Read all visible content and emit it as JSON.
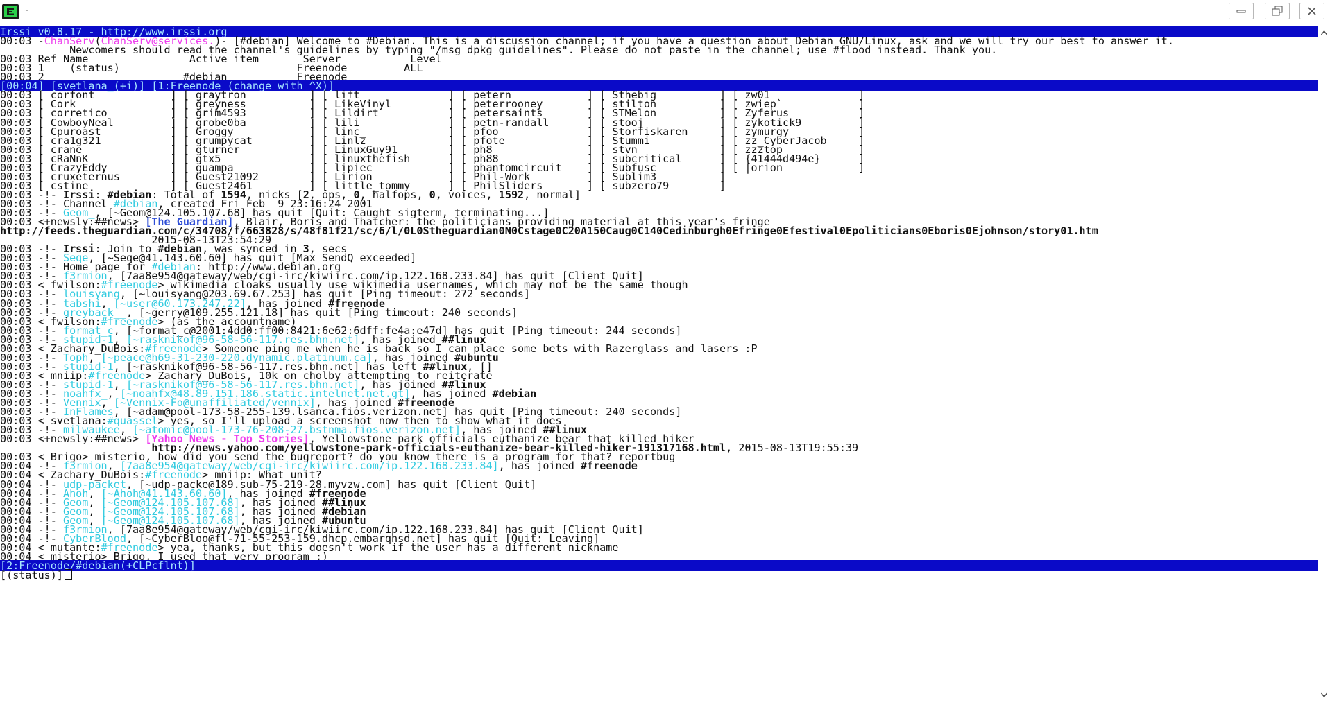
{
  "window": {
    "title": "~"
  },
  "icons": {
    "app": "terminal-app-icon",
    "minimize": "minimize-icon",
    "maximize": "restore-icon",
    "close": "close-icon",
    "scroll_up": "arrow-up-icon",
    "scroll_down": "arrow-down-icon"
  },
  "colors": {
    "status_bar_bg": "#0a0ac8",
    "status_bar_fg": "#a6e4ff",
    "nick_cyan": "#31cbe0",
    "nick_magenta": "#ee3dee",
    "link_blue": "#2d4dd6",
    "text": "#111111",
    "background": "#ffffff"
  },
  "prompt": {
    "window_label": "[(status)]"
  },
  "lines": [
    [
      [
        "",
        "Irssi v0.8.17 - http://www.irssi.org"
      ]
    ],
    [
      [
        "",
        "00:03 -"
      ],
      [
        "m",
        "ChanServ"
      ],
      [
        "",
        "("
      ],
      [
        "m",
        "ChanServ@services."
      ],
      [
        "",
        ")- [#debian] Welcome to #Debian. This is a discussion channel; if you have a question about Debian GNU/Linux, ask and we will try our best to answer it."
      ]
    ],
    [
      [
        "",
        "           Newcomers should read the channel's guidelines by typing \"/msg dpkg guidelines\". Please do not paste in the channel; use #flood instead. Thank you."
      ]
    ],
    [
      [
        "",
        "00:03 Ref Name                Active item       Server           Level"
      ]
    ],
    [
      [
        "",
        "00:03 1    (status)                            Freenode         ALL"
      ]
    ],
    [
      [
        "",
        "00:03 2                      #debian           Freenode"
      ]
    ],
    [
      [
        "",
        "[00:04] [svetlana_(+i)] [1:Freenode (change with ^X)]"
      ]
    ],
    [
      [
        "",
        "00:03 [ corfont            ] [ graytron          ] [ lift              ] [ petern_           ] [ Sthebig          ] [ zw01              ]"
      ]
    ],
    [
      [
        "",
        "00:03 [ Cork               ] [ greyness          ] [ LikeVinyl         ] [ peterrooney       ] [ stilton          ] [ zwiep`            ]"
      ]
    ],
    [
      [
        "",
        "00:03 [ corretico          ] [ grim4593          ] [ Lildirt           ] [ petersaints       ] [ STMelon          ] [ Zyferus           ]"
      ]
    ],
    [
      [
        "",
        "00:03 [ CowboyNeal         ] [ grobe0ba          ] [ lili              ] [ petn-randall      ] [ stooj            ] [ zykotick9         ]"
      ]
    ],
    [
      [
        "",
        "00:03 [ Cpuroast           ] [ Groggy            ] [ linc_             ] [ pfoo              ] [ Storfiskaren     ] [ zymurgy           ]"
      ]
    ],
    [
      [
        "",
        "00:03 [ cra1g321           ] [ grumpycat         ] [ Linlz             ] [ pfote             ] [ Stummi           ] [ zz_CyberJacob     ]"
      ]
    ],
    [
      [
        "",
        "00:03 [ crane              ] [ gturner           ] [ LinuxGuy91        ] [ ph8               ] [ stvn             ] [ zzztop            ]"
      ]
    ],
    [
      [
        "",
        "00:03 [ cRaNnK             ] [ gtx5              ] [ linuxthefish      ] [ ph88              ] [ subcritical      ] [ {41444d494e}      ]"
      ]
    ],
    [
      [
        "",
        "00:03 [ CrazyEddy          ] [ guampa            ] [ lipiec            ] [ phantomcircuit    ] [ Subfusc          ] [ |orion            ]"
      ]
    ],
    [
      [
        "",
        "00:03 [ cruxeternus        ] [ Guest21092        ] [ Lirion            ] [ Phil-Work         ] [ Sublim3          ]"
      ]
    ],
    [
      [
        "",
        "00:03 [ cstine             ] [ Guest2461         ] [ little_tommy      ] [ PhilSliders       ] [ subzero79        ]"
      ]
    ],
    [
      [
        "",
        "00:03 -!- "
      ],
      [
        "b",
        "Irssi"
      ],
      [
        "",
        ": "
      ],
      [
        "b",
        "#debian"
      ],
      [
        "",
        ": Total of "
      ],
      [
        "b",
        "1594"
      ],
      [
        "",
        ", nicks ["
      ],
      [
        "b",
        "2"
      ],
      [
        "",
        ", ops, "
      ],
      [
        "b",
        "0"
      ],
      [
        "",
        ", halfops, "
      ],
      [
        "b",
        "0"
      ],
      [
        "",
        ", voices, "
      ],
      [
        "b",
        "1592"
      ],
      [
        "",
        ", normal]"
      ]
    ],
    [
      [
        "",
        "00:03 -!- Channel "
      ],
      [
        "c",
        "#debian"
      ],
      [
        "",
        ", created Fri Feb  9 23:16:24 2001"
      ]
    ],
    [
      [
        "",
        "00:03 -!- "
      ],
      [
        "c",
        "Geom_"
      ],
      [
        "",
        ", [~Geom@124.105.107.68] has quit [Quit: Caught sigterm, terminating...]"
      ]
    ],
    [
      [
        "",
        "00:03 <+newsly:##news> "
      ],
      [
        "bl",
        "[The Guardian]"
      ],
      [
        "",
        ", Blair, Boris and Thatcher: the politicians providing material at this year's fringe"
      ]
    ],
    [
      [
        "b",
        "http://feeds.theguardian.com/c/34708/f/663828/s/48f81f21/sc/6/l/0L0Stheguardian0N0Cstage0C20A150Caug0C140Cedinburgh0Efringe0Efestival0Epoliticians0Eboris0Ejohnson/story01.htm"
      ]
    ],
    [
      [
        "",
        "                        2015-08-13T23:54:29"
      ]
    ],
    [
      [
        "",
        "00:03 -!- "
      ],
      [
        "b",
        "Irssi"
      ],
      [
        "",
        ": Join to "
      ],
      [
        "b",
        "#debian"
      ],
      [
        "",
        ", was synced in "
      ],
      [
        "b",
        "3"
      ],
      [
        "",
        ", secs"
      ]
    ],
    [
      [
        "",
        "00:03 -!- "
      ],
      [
        "c",
        "Seqe"
      ],
      [
        "",
        ", [~Seqe@41.143.60.60] has quit [Max SendQ exceeded]"
      ]
    ],
    [
      [
        "",
        "00:03 -!- Home page for "
      ],
      [
        "c",
        "#debian"
      ],
      [
        "",
        ": http://www.debian.org"
      ]
    ],
    [
      [
        "",
        "00:03 -!- "
      ],
      [
        "c",
        "f3rmion"
      ],
      [
        "",
        ", [7aa8e954@gateway/web/cgi-irc/kiwiirc.com/ip.122.168.233.84] has quit [Client Quit]"
      ]
    ],
    [
      [
        "",
        "00:03 < fwilson:"
      ],
      [
        "c",
        "#freenode"
      ],
      [
        "",
        "> wikimedia cloaks usually use wikimedia usernames, which may not be the same though"
      ]
    ],
    [
      [
        "",
        "00:03 -!- "
      ],
      [
        "c",
        "louisyang"
      ],
      [
        "",
        ", [~louisyang@203.69.67.253] has quit [Ping timeout: 272 seconds]"
      ]
    ],
    [
      [
        "",
        "00:03 -!- "
      ],
      [
        "c",
        "tabshi"
      ],
      [
        "",
        ", "
      ],
      [
        "c",
        "[~user@60.173.247.22]"
      ],
      [
        "",
        ", has joined "
      ],
      [
        "b",
        "#freenode"
      ]
    ],
    [
      [
        "",
        "00:03 -!- "
      ],
      [
        "c",
        "greyback__"
      ],
      [
        "",
        ", [~gerry@109.255.121.18] has quit [Ping timeout: 240 seconds]"
      ]
    ],
    [
      [
        "",
        "00:03 < fwilson:"
      ],
      [
        "c",
        "#freenode"
      ],
      [
        "",
        "> (as the accountname)"
      ]
    ],
    [
      [
        "",
        "00:03 -!- "
      ],
      [
        "c",
        "format_c"
      ],
      [
        "",
        ", [~format_c@2001:4dd0:ff00:8421:6e62:6dff:fe4a:e47d] has quit [Ping timeout: 244 seconds]"
      ]
    ],
    [
      [
        "",
        "00:03 -!- "
      ],
      [
        "c",
        "stupid-1"
      ],
      [
        "",
        ", "
      ],
      [
        "c",
        "[~rasknikof@96-58-56-117.res.bhn.net]"
      ],
      [
        "",
        ", has joined "
      ],
      [
        "b",
        "##linux"
      ]
    ],
    [
      [
        "",
        "00:03 < Zachary_DuBois:"
      ],
      [
        "c",
        "#freenode"
      ],
      [
        "",
        "> Someone ping me when he is back so I can place some bets with Razerglass and lasers :P"
      ]
    ],
    [
      [
        "",
        "00:03 -!- "
      ],
      [
        "c",
        "Toph"
      ],
      [
        "",
        ", "
      ],
      [
        "c",
        "[~peace@h69-31-230-220.dynamic.platinum.ca]"
      ],
      [
        "",
        ", has joined "
      ],
      [
        "b",
        "#ubuntu"
      ]
    ],
    [
      [
        "",
        "00:03 -!- "
      ],
      [
        "c",
        "stupid-1"
      ],
      [
        "",
        ", [~rasknikof@96-58-56-117.res.bhn.net] has left "
      ],
      [
        "b",
        "##linux"
      ],
      [
        "",
        ", []"
      ]
    ],
    [
      [
        "",
        "00:03 < mniip:"
      ],
      [
        "c",
        "#freenode"
      ],
      [
        "",
        "> Zachary_DuBois, 10k on cholby attempting to reiterate"
      ]
    ],
    [
      [
        "",
        "00:03 -!- "
      ],
      [
        "c",
        "stupid-1"
      ],
      [
        "",
        ", "
      ],
      [
        "c",
        "[~rasknikof@96-58-56-117.res.bhn.net]"
      ],
      [
        "",
        ", has joined "
      ],
      [
        "b",
        "##linux"
      ]
    ],
    [
      [
        "",
        "00:03 -!- "
      ],
      [
        "c",
        "noahfx_"
      ],
      [
        "",
        ", "
      ],
      [
        "c",
        "[~noahfx@48.89.151.186.static.intelnet.net.gt]"
      ],
      [
        "",
        ", has joined "
      ],
      [
        "b",
        "#debian"
      ]
    ],
    [
      [
        "",
        "00:03 -!- "
      ],
      [
        "c",
        "Vennix"
      ],
      [
        "",
        ", "
      ],
      [
        "c",
        "[~Vennix-Fo@unaffiliated/vennix]"
      ],
      [
        "",
        ", has joined "
      ],
      [
        "b",
        "#freenode"
      ]
    ],
    [
      [
        "",
        "00:03 -!- "
      ],
      [
        "c",
        "InFlames"
      ],
      [
        "",
        ", [~adam@pool-173-58-255-139.lsanca.fios.verizon.net] has quit [Ping timeout: 240 seconds]"
      ]
    ],
    [
      [
        "",
        "00:03 < svetlana:"
      ],
      [
        "c",
        "#quassel"
      ],
      [
        "",
        "> yes, so I'll upload a screenshot now then to show what it does"
      ]
    ],
    [
      [
        "",
        "00:03 -!- "
      ],
      [
        "c",
        "milwaukee"
      ],
      [
        "",
        ", "
      ],
      [
        "c",
        "[~atomic@pool-173-76-208-27.bstnma.fios.verizon.net]"
      ],
      [
        "",
        ", has joined "
      ],
      [
        "b",
        "##linux"
      ]
    ],
    [
      [
        "",
        "00:03 <+newsly:##news> "
      ],
      [
        "mb",
        "[Yahoo News - Top Stories]"
      ],
      [
        "",
        ", Yellowstone park officials euthanize bear that killed hiker"
      ]
    ],
    [
      [
        "",
        "                        "
      ],
      [
        "b",
        "http://news.yahoo.com/yellowstone-park-officials-euthanize-bear-killed-hiker-191317168.html"
      ],
      [
        "",
        ", 2015-08-13T19:55:39"
      ]
    ],
    [
      [
        "",
        "00:03 < Brigo> misterio, how did you send the bugreport? do you know there is a program for that? reportbug"
      ]
    ],
    [
      [
        "",
        "00:04 -!- "
      ],
      [
        "c",
        "f3rmion"
      ],
      [
        "",
        ", "
      ],
      [
        "c",
        "[7aa8e954@gateway/web/cgi-irc/kiwiirc.com/ip.122.168.233.84]"
      ],
      [
        "",
        ", has joined "
      ],
      [
        "b",
        "#freenode"
      ]
    ],
    [
      [
        "",
        "00:04 < Zachary_DuBois:"
      ],
      [
        "c",
        "#freenode"
      ],
      [
        "",
        "> mniip: What unit?"
      ]
    ],
    [
      [
        "",
        "00:04 -!- "
      ],
      [
        "c",
        "udp-packet"
      ],
      [
        "",
        ", [~udp-packe@189.sub-75-219-28.myvzw.com] has quit [Client Quit]"
      ]
    ],
    [
      [
        "",
        "00:04 -!- "
      ],
      [
        "c",
        "Ahoh"
      ],
      [
        "",
        ", "
      ],
      [
        "c",
        "[~Ahoh@41.143.60.60]"
      ],
      [
        "",
        ", has joined "
      ],
      [
        "b",
        "#freenode"
      ]
    ],
    [
      [
        "",
        "00:04 -!- "
      ],
      [
        "c",
        "Geom"
      ],
      [
        "",
        ", "
      ],
      [
        "c",
        "[~Geom@124.105.107.68]"
      ],
      [
        "",
        ", has joined "
      ],
      [
        "b",
        "##linux"
      ]
    ],
    [
      [
        "",
        "00:04 -!- "
      ],
      [
        "c",
        "Geom"
      ],
      [
        "",
        ", "
      ],
      [
        "c",
        "[~Geom@124.105.107.68]"
      ],
      [
        "",
        ", has joined "
      ],
      [
        "b",
        "#debian"
      ]
    ],
    [
      [
        "",
        "00:04 -!- "
      ],
      [
        "c",
        "Geom"
      ],
      [
        "",
        ", "
      ],
      [
        "c",
        "[~Geom@124.105.107.68]"
      ],
      [
        "",
        ", has joined "
      ],
      [
        "b",
        "#ubuntu"
      ]
    ],
    [
      [
        "",
        "00:04 -!- "
      ],
      [
        "c",
        "f3rmion"
      ],
      [
        "",
        ", [7aa8e954@gateway/web/cgi-irc/kiwiirc.com/ip.122.168.233.84] has quit [Client Quit]"
      ]
    ],
    [
      [
        "",
        "00:04 -!- "
      ],
      [
        "c",
        "CyberBlood"
      ],
      [
        "",
        ", [~CyberBloo@fl-71-55-253-159.dhcp.embarqhsd.net] has quit [Quit: Leaving]"
      ]
    ],
    [
      [
        "",
        "00:04 < mutante:"
      ],
      [
        "c",
        "#freenode"
      ],
      [
        "",
        "> yea, thanks, but this doesn't work if the user has a different nickname"
      ]
    ],
    [
      [
        "",
        "00:04 < misterio> Brigo, I used that very program :)"
      ]
    ],
    [
      [
        "",
        "[2:Freenode/#debian(+CLPcflnt)]"
      ]
    ]
  ]
}
